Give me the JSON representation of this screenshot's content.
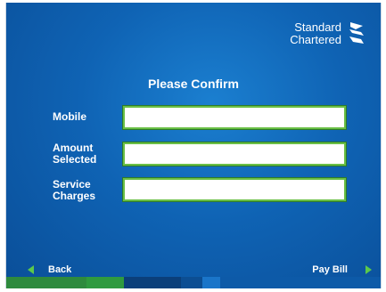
{
  "brand": {
    "line1": "Standard",
    "line2": "Chartered"
  },
  "title": "Please Confirm",
  "fields": [
    {
      "label_line1": "Mobile",
      "label_line2": "",
      "value": ""
    },
    {
      "label_line1": "Amount",
      "label_line2": "Selected",
      "value": ""
    },
    {
      "label_line1": "Service",
      "label_line2": "Charges",
      "value": ""
    }
  ],
  "nav": {
    "back_label": "Back",
    "pay_label": "Pay Bill"
  },
  "colors": {
    "accent_green": "#5cc94a",
    "background_blue": "#0f63b4",
    "field_border": "#6abf45",
    "footer": [
      "#2e8a3d",
      "#2f9a3f",
      "#0b3f7a",
      "#0c4e93",
      "#1a75c9",
      "#0d5aa8"
    ]
  }
}
